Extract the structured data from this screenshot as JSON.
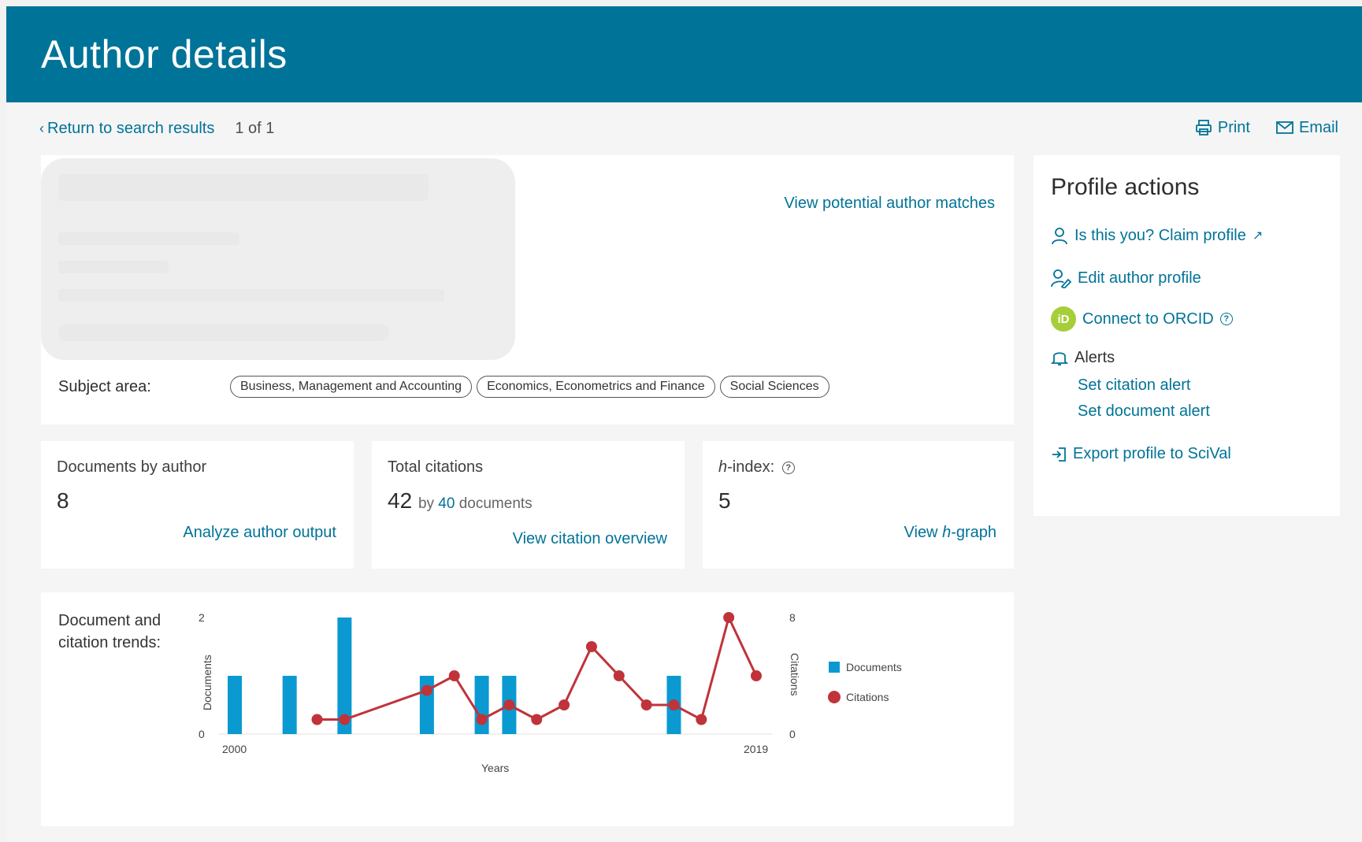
{
  "header": {
    "title": "Author details"
  },
  "topnav": {
    "back_label": "Return to search results",
    "count": "1 of 1"
  },
  "toolbar": {
    "print": "Print",
    "email": "Email"
  },
  "author": {
    "potential_matches": "View potential author matches",
    "subject_label": "Subject area:",
    "subjects": [
      "Business, Management and Accounting",
      "Economics, Econometrics and Finance",
      "Social Sciences"
    ]
  },
  "metrics": {
    "documents": {
      "label": "Documents by author",
      "value": "8",
      "action": "Analyze author output"
    },
    "citations": {
      "label": "Total citations",
      "value": "42",
      "by": "by",
      "docs_count": "40",
      "docs_word": "documents",
      "action": "View citation overview"
    },
    "hindex": {
      "label_italic": "h",
      "label_rest": "-index:",
      "value": "5",
      "action_pre": "View ",
      "action_italic": "h",
      "action_post": "-graph"
    }
  },
  "trend": {
    "label_line1": "Document and",
    "label_line2": "citation trends:"
  },
  "profile": {
    "title": "Profile actions",
    "claim": "Is this you? Claim profile",
    "edit": "Edit author profile",
    "orcid": "Connect to ORCID",
    "orcid_badge": "iD",
    "alerts": "Alerts",
    "citation_alert": "Set citation alert",
    "document_alert": "Set document alert",
    "export": "Export profile to SciVal"
  },
  "colors": {
    "brand": "#007398",
    "documents": "#0a9ad1",
    "citations": "#c0333b",
    "orcid": "#a6ce39"
  },
  "chart_data": {
    "type": "bar",
    "xlabel": "Years",
    "ylabel_left": "Documents",
    "ylabel_right": "Citations",
    "x_tick_labels": [
      "2000",
      "2019"
    ],
    "ylim_left": [
      0,
      2
    ],
    "ylim_right": [
      0,
      8
    ],
    "y_ticks_left": [
      "0",
      "2"
    ],
    "y_ticks_right": [
      "0",
      "8"
    ],
    "legend_position": "right",
    "categories": [
      2000,
      2001,
      2002,
      2003,
      2004,
      2005,
      2006,
      2007,
      2008,
      2009,
      2010,
      2011,
      2012,
      2013,
      2014,
      2015,
      2016,
      2017,
      2018,
      2019
    ],
    "series": [
      {
        "name": "Documents",
        "type": "bar",
        "values": [
          1,
          0,
          1,
          0,
          2,
          0,
          0,
          1,
          0,
          1,
          1,
          0,
          0,
          0,
          0,
          0,
          1,
          0,
          0,
          0
        ]
      },
      {
        "name": "Citations",
        "type": "line",
        "values": [
          null,
          null,
          null,
          1,
          1,
          null,
          null,
          3,
          4,
          1,
          2,
          1,
          2,
          6,
          4,
          2,
          2,
          1,
          8,
          4
        ]
      }
    ]
  }
}
